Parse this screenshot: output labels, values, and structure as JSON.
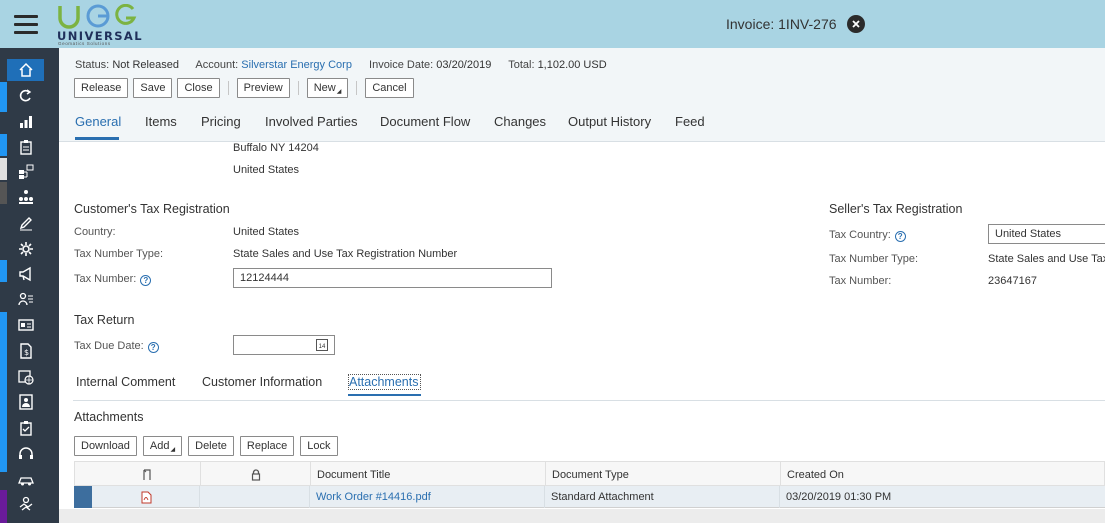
{
  "header": {
    "logo_text": "UNIVERSAL",
    "logo_sub": "Geomatics Solutions",
    "window_title": "Invoice: 1INV-276"
  },
  "object_header": {
    "status_label": "Status:",
    "status_value": "Not Released",
    "account_label": "Account:",
    "account_value": "Silverstar Energy Corp",
    "invoice_date_label": "Invoice Date:",
    "invoice_date_value": "03/20/2019",
    "total_label": "Total:",
    "total_value": "1,102.00 USD",
    "buttons": {
      "release": "Release",
      "save": "Save",
      "close": "Close",
      "preview": "Preview",
      "new": "New",
      "cancel": "Cancel"
    },
    "tabs": [
      "General",
      "Items",
      "Pricing",
      "Involved Parties",
      "Document Flow",
      "Changes",
      "Output History",
      "Feed"
    ],
    "active_tab": "General"
  },
  "address": {
    "line1": "Buffalo NY  14204",
    "line2": "United States"
  },
  "customer_tax": {
    "title": "Customer's Tax Registration",
    "country_label": "Country:",
    "country_value": "United States",
    "tax_number_type_label": "Tax Number Type:",
    "tax_number_type_value": "State Sales and Use Tax Registration Number",
    "tax_number_label": "Tax Number:",
    "tax_number_value": "12124444"
  },
  "seller_tax": {
    "title": "Seller's Tax Registration",
    "tax_country_label": "Tax Country:",
    "tax_country_value": "United States",
    "tax_number_type_label": "Tax Number Type:",
    "tax_number_type_value": "State Sales and Use Tax",
    "tax_number_label": "Tax Number:",
    "tax_number_value": "23647167"
  },
  "tax_return": {
    "title": "Tax Return",
    "due_date_label": "Tax Due Date:",
    "due_date_value": "",
    "calendar_text": "14"
  },
  "subtabs": [
    "Internal Comment",
    "Customer Information",
    "Attachments"
  ],
  "active_subtab": "Attachments",
  "attachments": {
    "title": "Attachments",
    "buttons": {
      "download": "Download",
      "add": "Add",
      "delete": "Delete",
      "replace": "Replace",
      "lock": "Lock"
    },
    "columns": [
      "Document Title",
      "Document Type",
      "Created On"
    ],
    "rows": [
      {
        "title": "Work Order #14416.pdf",
        "type": "Standard Attachment",
        "created": "03/20/2019 01:30 PM"
      }
    ]
  },
  "colors": {
    "header_bg": "#a9d4e3",
    "nav_bg": "#2f3a47",
    "nav_active": "#1f6fb8",
    "link": "#2a6fb0"
  },
  "icons": [
    "menu-icon",
    "home-icon",
    "refresh-icon",
    "bar-chart-icon",
    "clipboard-icon",
    "hierarchy-icon",
    "org-chart-icon",
    "edit-icon",
    "gear-icon",
    "megaphone-icon",
    "person-list-icon",
    "id-card-icon",
    "document-icon",
    "calendar-globe-icon",
    "contact-card-icon",
    "clipboard-check-icon",
    "headset-icon",
    "truck-icon",
    "handshake-icon",
    "close-icon",
    "help-icon",
    "calendar-icon",
    "file-icon",
    "lock-icon",
    "pdf-icon"
  ]
}
